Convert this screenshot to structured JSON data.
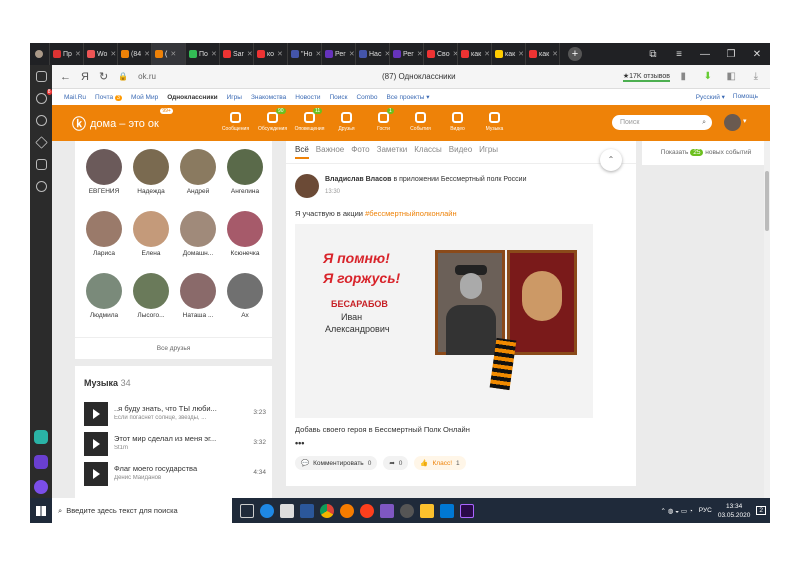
{
  "browser": {
    "tabs": [
      {
        "label": "Пр",
        "color": "#d33"
      },
      {
        "label": "Wo",
        "color": "#e55"
      },
      {
        "label": "(84",
        "color": "#ee8208"
      },
      {
        "label": "(",
        "color": "#ee8208",
        "active": true
      },
      {
        "label": "По",
        "color": "#3b5"
      },
      {
        "label": "Sar",
        "color": "#e33"
      },
      {
        "label": "ко",
        "color": "#e33"
      },
      {
        "label": "\"Но",
        "color": "#45a"
      },
      {
        "label": "Рег",
        "color": "#63b"
      },
      {
        "label": "Нас",
        "color": "#45a"
      },
      {
        "label": "Рег",
        "color": "#63b"
      },
      {
        "label": "Сво",
        "color": "#e33"
      },
      {
        "label": "как",
        "color": "#e33"
      },
      {
        "label": "как",
        "color": "#fc0"
      },
      {
        "label": "как",
        "color": "#e33"
      }
    ],
    "newtab": "+",
    "win_controls": [
      "⧉",
      "≡",
      "—",
      "❐",
      "✕"
    ],
    "nav_back": "←",
    "nav_ya": "Я",
    "reload": "↻",
    "url": "ok.ru",
    "page_title": "(87) Одноклассники",
    "rating": "★17K отзывов"
  },
  "side_panel": {
    "badge": "8"
  },
  "oknav": {
    "items": [
      "Mail.Ru",
      "Почта",
      "Мой Мир",
      "Одноклассники",
      "Игры",
      "Знакомства",
      "Новости",
      "Поиск",
      "Combo",
      "Все проекты ▾"
    ],
    "mail_count": "3",
    "lang": "Русский ▾",
    "help": "Помощь"
  },
  "header": {
    "logo_text": "дома – это ок",
    "logo_badge": "99+",
    "tools": [
      {
        "label": "Сообщения",
        "num": ""
      },
      {
        "label": "Обсуждения",
        "num": "90"
      },
      {
        "label": "Оповещения",
        "num": "11"
      },
      {
        "label": "Друзья",
        "num": ""
      },
      {
        "label": "Гости",
        "num": "1"
      },
      {
        "label": "События",
        "num": ""
      },
      {
        "label": "Видео",
        "num": ""
      },
      {
        "label": "Музыка",
        "num": ""
      }
    ],
    "search_placeholder": "Поиск"
  },
  "friends": {
    "list": [
      "ЕВГЕНИЯ",
      "Надежда",
      "Андрей",
      "Ангелина",
      "Лариса",
      "Елена",
      "Домашн...",
      "Ксюнечка",
      "Людмила",
      "Лысого...",
      "Наташа ...",
      "Ах"
    ],
    "all_label": "Все друзья"
  },
  "music": {
    "title": "Музыка",
    "count": "34",
    "tracks": [
      {
        "title": "..я буду знать, что ТЫ люби...",
        "artist": "Если погаснет солнце, звезды, ...",
        "dur": "3:23"
      },
      {
        "title": "Этот мир сделал из меня эг...",
        "artist": "St1m",
        "dur": "3:32"
      },
      {
        "title": "Флаг моего государства",
        "artist": "Денис Майданов",
        "dur": "4:34"
      }
    ]
  },
  "feed": {
    "tabs": [
      "Всё",
      "Важное",
      "Фото",
      "Заметки",
      "Классы",
      "Видео",
      "Игры"
    ],
    "post": {
      "author": "Владислав Власов",
      "app_text": "в приложении Бессмертный полк России",
      "time": "13:30",
      "text": "Я участвую в акции",
      "hashtag": "#бессмертныйполконлайн",
      "img_line1": "Я помню!",
      "img_line2": "Я горжусь!",
      "img_surname": "БЕСАРАБОВ",
      "img_name": "Иван",
      "img_patronymic": "Александрович",
      "caption": "Добавь своего героя в Бессмертный Полк Онлайн",
      "dots": "•••",
      "comment_label": "Комментировать",
      "comment_count": "0",
      "share_count": "0",
      "klass_label": "Класс!",
      "klass_count": "1"
    }
  },
  "events": {
    "prefix": "Показать",
    "count": "25",
    "suffix": "новых событий"
  },
  "taskbar": {
    "search_placeholder": "Введите здесь текст для поиска",
    "lang": "РУС",
    "time": "13:34",
    "date": "03.05.2020",
    "notif": "2"
  }
}
